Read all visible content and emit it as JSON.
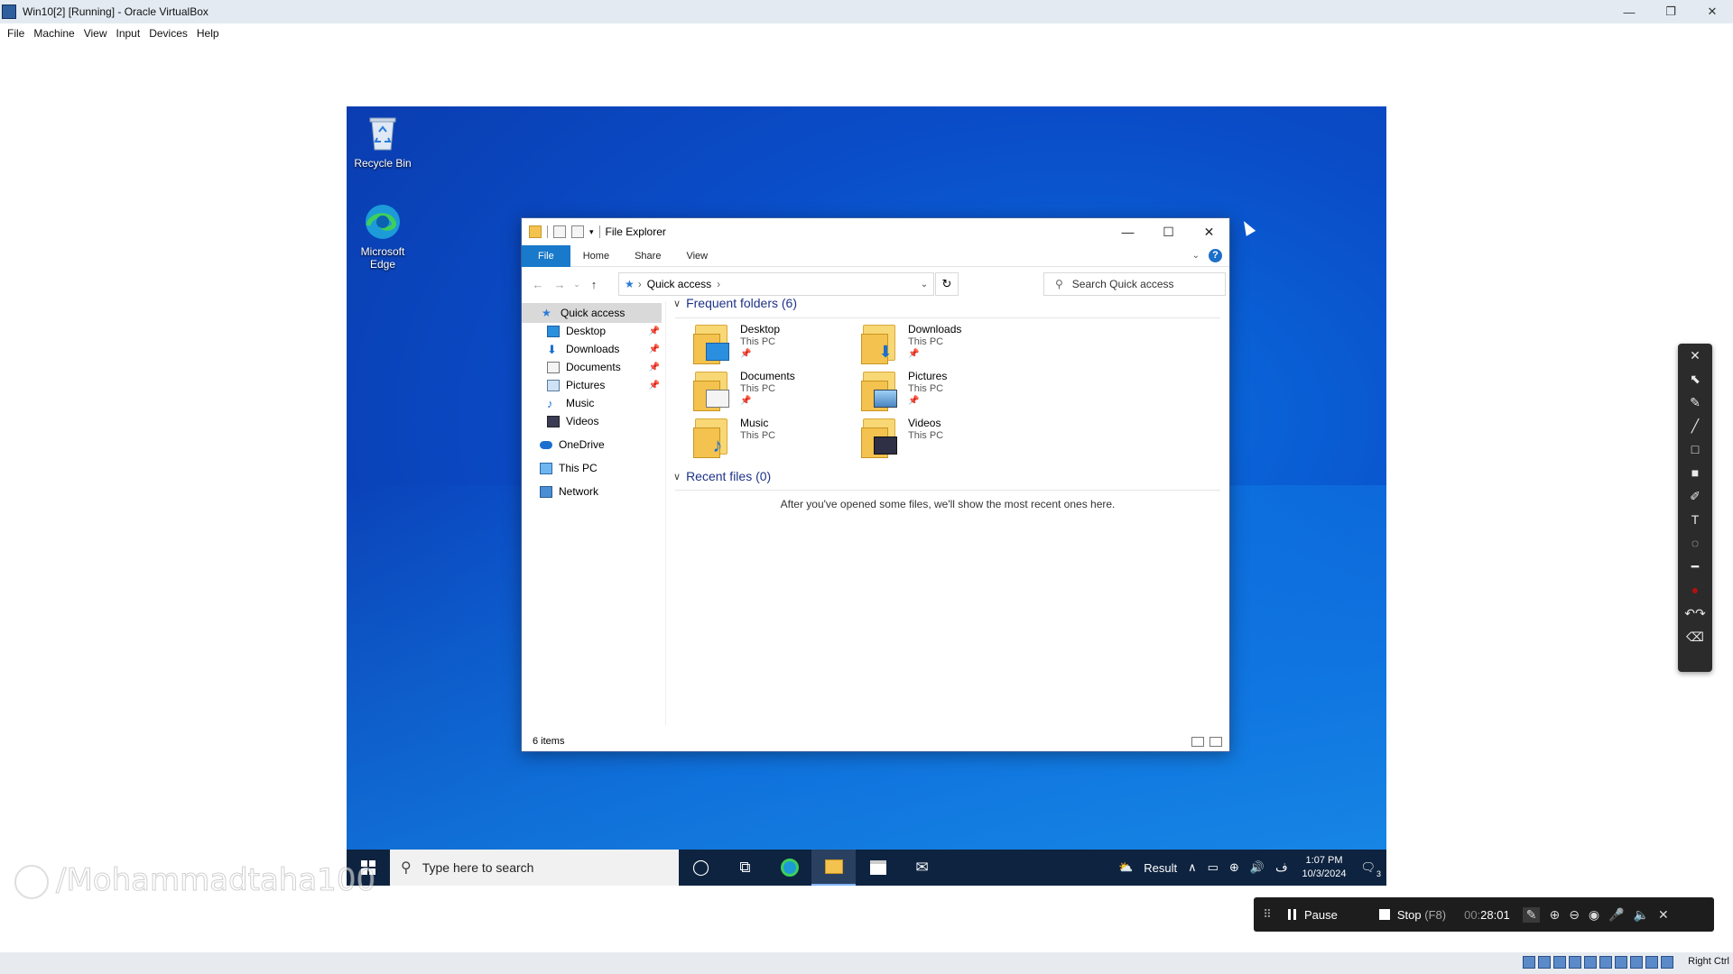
{
  "host": {
    "title": "Win10[2] [Running] - Oracle VirtualBox",
    "menu": [
      "File",
      "Machine",
      "View",
      "Input",
      "Devices",
      "Help"
    ],
    "controls": {
      "minimize": "—",
      "restore": "❐",
      "close": "✕"
    },
    "status_right": "Right Ctrl"
  },
  "desktop": {
    "icons": [
      {
        "label": "Recycle Bin",
        "icon": "recycle-bin-icon"
      },
      {
        "label": "Microsoft Edge",
        "icon": "edge-icon"
      }
    ]
  },
  "explorer": {
    "title": "File Explorer",
    "ribbon_tabs": [
      "File",
      "Home",
      "Share",
      "View"
    ],
    "address": {
      "segment": "Quick access"
    },
    "search_placeholder": "Search Quick access",
    "sidebar": [
      {
        "label": "Quick access",
        "icon": "star-icon",
        "selected": true
      },
      {
        "label": "Desktop",
        "icon": "desktop-icon",
        "pinned": true
      },
      {
        "label": "Downloads",
        "icon": "download-arrow-icon",
        "pinned": true
      },
      {
        "label": "Documents",
        "icon": "document-icon",
        "pinned": true
      },
      {
        "label": "Pictures",
        "icon": "pictures-icon",
        "pinned": true
      },
      {
        "label": "Music",
        "icon": "music-note-icon"
      },
      {
        "label": "Videos",
        "icon": "video-icon"
      },
      {
        "label": "OneDrive",
        "icon": "cloud-icon"
      },
      {
        "label": "This PC",
        "icon": "monitor-icon"
      },
      {
        "label": "Network",
        "icon": "network-icon"
      }
    ],
    "frequent_header": "Frequent folders (6)",
    "frequent": [
      {
        "name": "Desktop",
        "location": "This PC",
        "pinned": true
      },
      {
        "name": "Downloads",
        "location": "This PC",
        "pinned": true
      },
      {
        "name": "Documents",
        "location": "This PC",
        "pinned": true
      },
      {
        "name": "Pictures",
        "location": "This PC",
        "pinned": true
      },
      {
        "name": "Music",
        "location": "This PC",
        "pinned": false
      },
      {
        "name": "Videos",
        "location": "This PC",
        "pinned": false
      }
    ],
    "recent_header": "Recent files (0)",
    "recent_empty": "After you've opened some files, we'll show the most recent ones here.",
    "status": "6 items"
  },
  "taskbar": {
    "search_placeholder": "Type here to search",
    "weather": "Result",
    "time": "1:07 PM",
    "date": "10/3/2024",
    "notifications": "3"
  },
  "recorder": {
    "pause": "Pause",
    "stop": "Stop",
    "stop_key": "(F8)",
    "time_prefix": "00:",
    "time": "28:01"
  },
  "watermark": "/Mohammadtaha100",
  "colors": {
    "accent": "#1979ca",
    "desktop": "#0a4dc8",
    "taskbar": "#0d2340"
  }
}
